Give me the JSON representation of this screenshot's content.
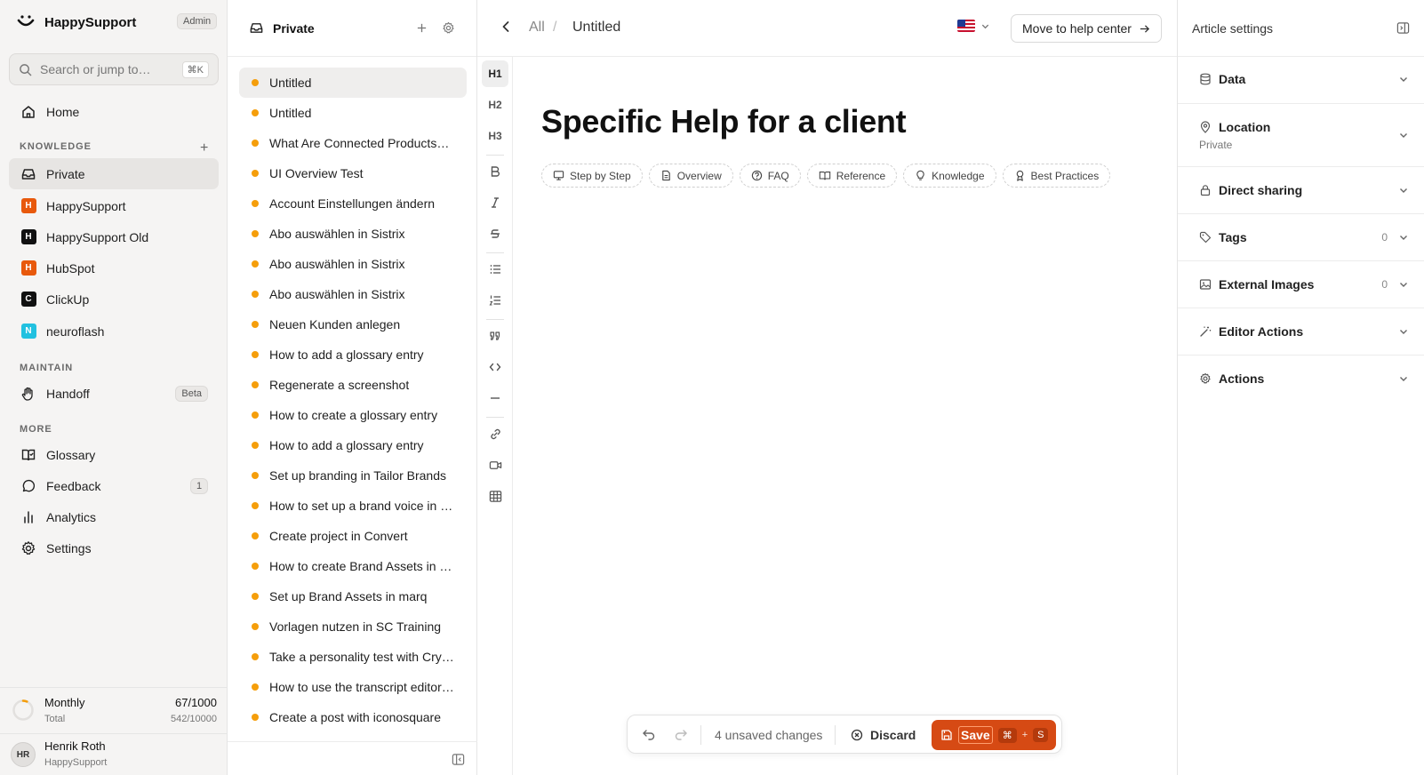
{
  "app": {
    "name": "HappySupport",
    "role_badge": "Admin"
  },
  "search": {
    "placeholder": "Search or jump to…",
    "shortcut": "⌘K"
  },
  "sidebar": {
    "home_label": "Home",
    "knowledge_label": "KNOWLEDGE",
    "spaces": [
      {
        "label": "Private",
        "icon": "inbox-icon"
      },
      {
        "label": "HappySupport",
        "letter": "H",
        "color": "#e8590c"
      },
      {
        "label": "HappySupport Old",
        "letter": "H",
        "color": "#111111"
      },
      {
        "label": "HubSpot",
        "letter": "H",
        "color": "#e8590c"
      },
      {
        "label": "ClickUp",
        "letter": "C",
        "color": "#111111"
      },
      {
        "label": "neuroflash",
        "letter": "N",
        "color": "#22c1e0"
      }
    ],
    "maintain_label": "MAINTAIN",
    "handoff": {
      "label": "Handoff",
      "badge": "Beta"
    },
    "more_label": "MORE",
    "more": [
      {
        "label": "Glossary",
        "icon": "book-check-icon"
      },
      {
        "label": "Feedback",
        "icon": "message-circle-icon",
        "count": "1"
      },
      {
        "label": "Analytics",
        "icon": "bar-chart-icon"
      },
      {
        "label": "Settings",
        "icon": "gear-icon"
      }
    ],
    "usage": {
      "label": "Monthly",
      "value": "67/1000",
      "sublabel": "Total",
      "subvalue": "542/10000",
      "progress": 0.067
    },
    "user": {
      "initials": "HR",
      "name": "Henrik Roth",
      "org": "HappySupport"
    }
  },
  "list": {
    "title": "Private",
    "articles": [
      "Untitled",
      "Untitled",
      "What Are Connected Products…",
      "UI Overview Test",
      "Account Einstellungen ändern",
      "Abo auswählen in Sistrix",
      "Abo auswählen in Sistrix",
      "Abo auswählen in Sistrix",
      "Neuen Kunden anlegen",
      "How to add a glossary entry",
      "Regenerate a screenshot",
      "How to create a glossary entry",
      "How to add a glossary entry",
      "Set up branding in Tailor Brands",
      "How to set up a brand voice in …",
      "Create project in Convert",
      "How to create Brand Assets in …",
      "Set up Brand Assets in marq",
      "Vorlagen nutzen in SC Training",
      "Take a personality test with Cry…",
      "How to use the transcript editor…",
      "Create a post with iconosquare"
    ],
    "selected_index": 0,
    "status_color": "#f59e0b"
  },
  "editor": {
    "breadcrumb_root": "All",
    "breadcrumb_sep": "/",
    "breadcrumb_current": "Untitled",
    "move_button": "Move to help center",
    "document_title": "Specific Help for a client",
    "templates": [
      {
        "label": "Step by Step",
        "icon": "monitor-icon"
      },
      {
        "label": "Overview",
        "icon": "file-text-icon"
      },
      {
        "label": "FAQ",
        "icon": "help-circle-icon"
      },
      {
        "label": "Reference",
        "icon": "book-open-icon"
      },
      {
        "label": "Knowledge",
        "icon": "lightbulb-icon"
      },
      {
        "label": "Best Practices",
        "icon": "award-icon"
      }
    ],
    "format_buttons": {
      "h1": "H1",
      "h2": "H2",
      "h3": "H3"
    },
    "savebar": {
      "changes": "4 unsaved changes",
      "discard": "Discard",
      "save": "Save",
      "shortcut_cmd": "⌘",
      "shortcut_plus": "+",
      "shortcut_key": "S"
    },
    "accent_color": "#d64a14"
  },
  "settings": {
    "title": "Article settings",
    "sections": {
      "data": "Data",
      "location": "Location",
      "location_value": "Private",
      "sharing": "Direct sharing",
      "tags": "Tags",
      "tags_count": "0",
      "images": "External Images",
      "images_count": "0",
      "editor_actions": "Editor Actions",
      "actions": "Actions"
    }
  }
}
